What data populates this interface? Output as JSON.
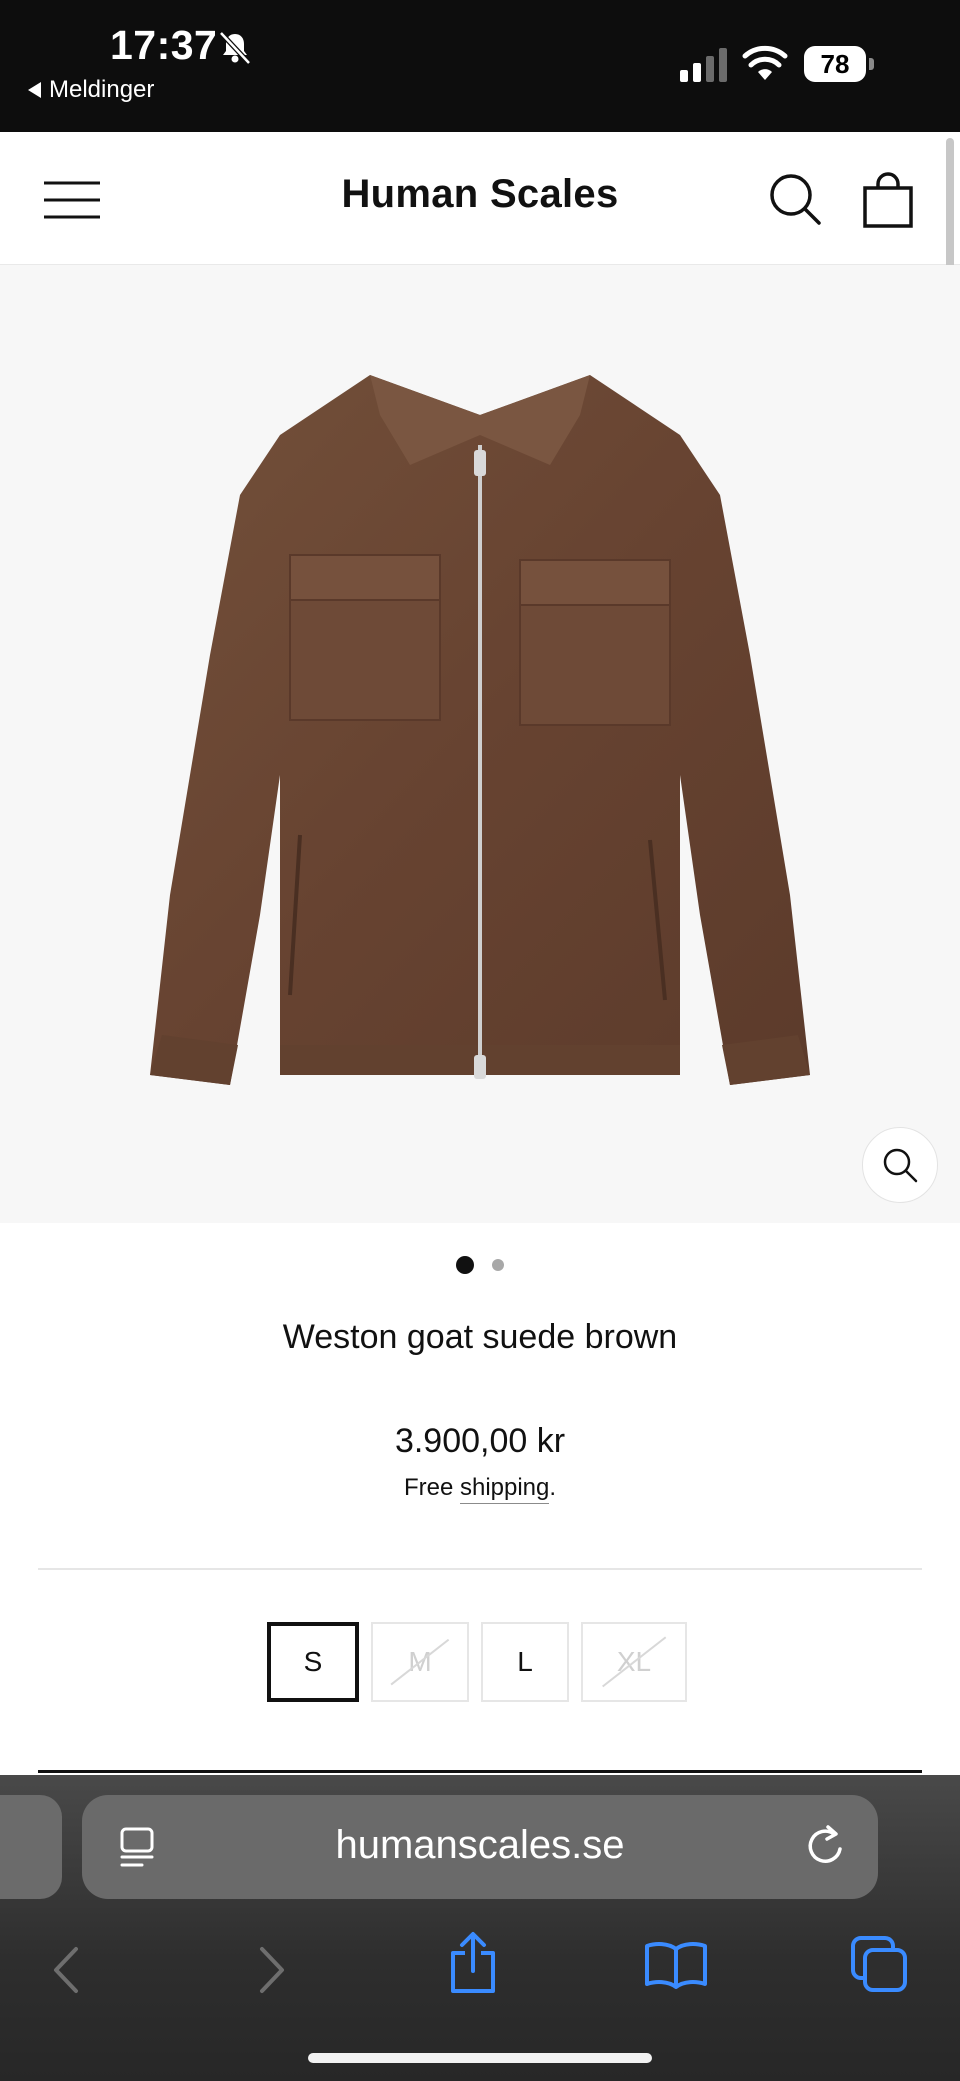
{
  "status_bar": {
    "time": "17:37",
    "back_app": "Meldinger",
    "battery": "78"
  },
  "header": {
    "brand": "Human Scales"
  },
  "product": {
    "title": "Weston goat suede brown",
    "price": "3.900,00 kr",
    "shipping_prefix": "Free ",
    "shipping_link": "shipping",
    "shipping_suffix": ".",
    "gallery_count": 2,
    "gallery_active_index": 0,
    "sizes": [
      {
        "label": "S",
        "state": "selected"
      },
      {
        "label": "M",
        "state": "sold-out"
      },
      {
        "label": "L",
        "state": "available"
      },
      {
        "label": "XL",
        "state": "sold-out"
      }
    ]
  },
  "browser": {
    "url": "humanscales.se"
  },
  "colors": {
    "statusbar_bg": "#0d0d0d",
    "jacket_brown": "#6b4632",
    "safari_toolbar": "#2e2e2e",
    "ios_blue": "#3a8bff"
  }
}
